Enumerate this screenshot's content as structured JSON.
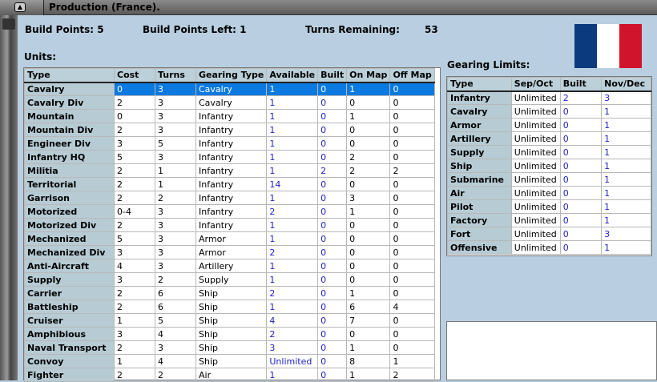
{
  "window": {
    "title": "Production (France)."
  },
  "stats": {
    "build_points": "Build Points: 5",
    "build_points_left": "Build Points Left:  1",
    "turns_remaining_label": "Turns Remaining:",
    "turns_remaining_value": "53"
  },
  "units": {
    "label": "Units:",
    "columns": [
      "Type",
      "Cost",
      "Turns",
      "Gearing Type",
      "Available",
      "Built",
      "On Map",
      "Off Map"
    ],
    "rows": [
      [
        "Cavalry",
        "0",
        "3",
        "Cavalry",
        "1",
        "0",
        "1",
        "0"
      ],
      [
        "Cavalry Div",
        "2",
        "3",
        "Cavalry",
        "1",
        "0",
        "0",
        "0"
      ],
      [
        "Mountain",
        "0",
        "3",
        "Infantry",
        "1",
        "0",
        "1",
        "0"
      ],
      [
        "Mountain Div",
        "2",
        "3",
        "Infantry",
        "1",
        "0",
        "0",
        "0"
      ],
      [
        "Engineer Div",
        "3",
        "5",
        "Infantry",
        "1",
        "0",
        "0",
        "0"
      ],
      [
        "Infantry HQ",
        "5",
        "3",
        "Infantry",
        "1",
        "0",
        "2",
        "0"
      ],
      [
        "Militia",
        "2",
        "1",
        "Infantry",
        "1",
        "2",
        "2",
        "2"
      ],
      [
        "Territorial",
        "2",
        "1",
        "Infantry",
        "14",
        "0",
        "0",
        "0"
      ],
      [
        "Garrison",
        "2",
        "2",
        "Infantry",
        "1",
        "0",
        "3",
        "0"
      ],
      [
        "Motorized",
        "0-4",
        "3",
        "Infantry",
        "2",
        "0",
        "1",
        "0"
      ],
      [
        "Motorized Div",
        "2",
        "3",
        "Infantry",
        "1",
        "0",
        "0",
        "0"
      ],
      [
        "Mechanized",
        "5",
        "3",
        "Armor",
        "1",
        "0",
        "0",
        "0"
      ],
      [
        "Mechanized Div",
        "3",
        "3",
        "Armor",
        "2",
        "0",
        "0",
        "0"
      ],
      [
        "Anti-Aircraft",
        "4",
        "3",
        "Artillery",
        "1",
        "0",
        "0",
        "0"
      ],
      [
        "Supply",
        "3",
        "2",
        "Supply",
        "1",
        "0",
        "0",
        "0"
      ],
      [
        "Carrier",
        "2",
        "6",
        "Ship",
        "2",
        "0",
        "1",
        "0"
      ],
      [
        "Battleship",
        "2",
        "6",
        "Ship",
        "1",
        "0",
        "6",
        "4"
      ],
      [
        "Cruiser",
        "1",
        "5",
        "Ship",
        "4",
        "0",
        "7",
        "0"
      ],
      [
        "Amphibious",
        "3",
        "4",
        "Ship",
        "2",
        "0",
        "0",
        "0"
      ],
      [
        "Naval Transport",
        "2",
        "3",
        "Ship",
        "3",
        "0",
        "1",
        "0"
      ],
      [
        "Convoy",
        "1",
        "4",
        "Ship",
        "Unlimited",
        "0",
        "8",
        "1"
      ],
      [
        "Fighter",
        "2",
        "2",
        "Air",
        "1",
        "0",
        "1",
        "2"
      ]
    ],
    "selected_index": 0
  },
  "gearing": {
    "label": "Gearing Limits:",
    "columns": [
      "Type",
      "Sep/Oct",
      "Built",
      "Nov/Dec"
    ],
    "rows": [
      [
        "Infantry",
        "Unlimited",
        "2",
        "3"
      ],
      [
        "Cavalry",
        "Unlimited",
        "0",
        "1"
      ],
      [
        "Armor",
        "Unlimited",
        "0",
        "1"
      ],
      [
        "Artillery",
        "Unlimited",
        "0",
        "1"
      ],
      [
        "Supply",
        "Unlimited",
        "0",
        "1"
      ],
      [
        "Ship",
        "Unlimited",
        "0",
        "1"
      ],
      [
        "Submarine",
        "Unlimited",
        "0",
        "1"
      ],
      [
        "Air",
        "Unlimited",
        "0",
        "1"
      ],
      [
        "Pilot",
        "Unlimited",
        "0",
        "1"
      ],
      [
        "Factory",
        "Unlimited",
        "0",
        "1"
      ],
      [
        "Fort",
        "Unlimited",
        "0",
        "3"
      ],
      [
        "Offensive",
        "Unlimited",
        "0",
        "1"
      ]
    ]
  },
  "flag_colors": [
    "#0b3a7e",
    "#ffffff",
    "#d0142c"
  ]
}
